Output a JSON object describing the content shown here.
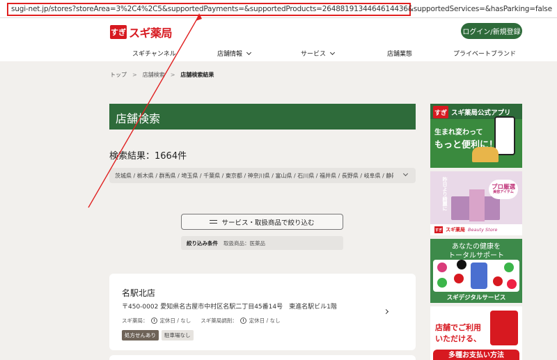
{
  "browser": {
    "url": "sugi-net.jp/stores?storeArea=3%2C4%2C5&supportedPayments=&supportedProducts=2648819134464614436&supportedServices=&hasParking=false"
  },
  "header": {
    "logo_mark": "すぎ",
    "logo_text": "スギ薬局",
    "login_label": "ログイン/新規登録",
    "nav": [
      {
        "label": "スギチャンネル"
      },
      {
        "label": "店舗情報"
      },
      {
        "label": "サービス"
      },
      {
        "label": "店舗業態"
      },
      {
        "label": "プライベートブランド"
      }
    ]
  },
  "breadcrumb": {
    "items": [
      "トップ",
      "店舗検索",
      "店舗検索結果"
    ],
    "separator": ">"
  },
  "main": {
    "title": "店舗検索",
    "result_count": "検索結果：1664件",
    "prefectures": "茨城県 / 栃木県 / 群馬県 / 埼玉県 / 千葉県 / 東京都 / 神奈川県 / 富山県 / 石川県 / 福井県 / 長野県 / 岐阜県 / 静岡県…",
    "filter_button": "サービス・取扱商品で絞り込む",
    "condition_label": "絞り込み条件",
    "condition_value": "取扱商品：医薬品"
  },
  "stores": [
    {
      "name": "名駅北店",
      "address": "〒450-0002 愛知県名古屋市中村区名駅二丁目45番14号　東進名駅ビル1階",
      "pharmacy_label": "スギ薬局：",
      "pharmacy_holiday": "定休日 / なし",
      "dispensing_label": "スギ薬局調剤：",
      "dispensing_holiday": "定休日 / なし",
      "tags": [
        "処方せんあり",
        "駐車場なし"
      ]
    }
  ],
  "banners": {
    "app": {
      "mark": "すぎ",
      "title": "スギ薬局公式アプリ",
      "line1": "生まれ変わって",
      "line2": "もっと便利に！"
    },
    "beauty": {
      "side_text": "昨日より綺麗に",
      "badge_main": "プロ厳選",
      "badge_sub": "美容アイテム",
      "mark": "すぎ",
      "brand": "スギ薬局",
      "brand2": "Beauty Store"
    },
    "digital": {
      "line1": "あなたの健康を",
      "line2": "トータルサポート",
      "footer": "スギデジタルサービス"
    },
    "payment": {
      "line1": "店舗でご利用",
      "line2": "いただける、",
      "bottom": "多種お支払い方法"
    }
  },
  "colors": {
    "brand_green": "#2e6b3a",
    "brand_red": "#d71920",
    "annotation_red": "#e02020"
  }
}
